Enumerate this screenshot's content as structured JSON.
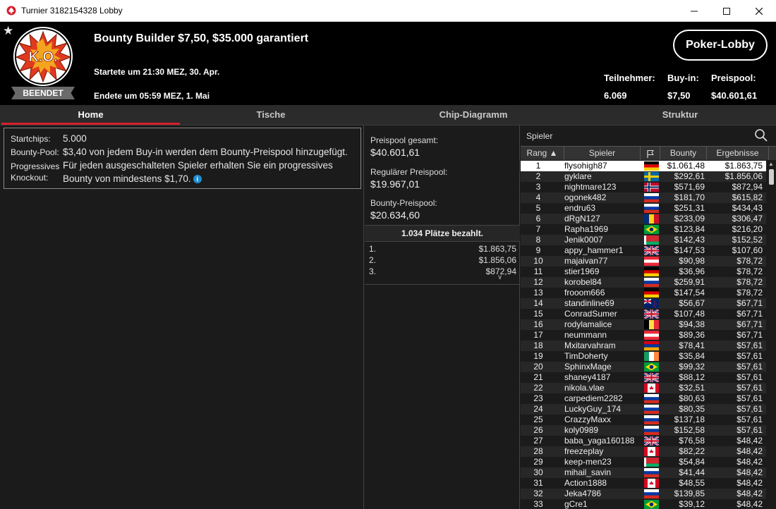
{
  "window": {
    "title": "Turnier 3182154328 Lobby"
  },
  "header": {
    "title": "Bounty Builder $7,50, $35.000 garantiert",
    "started": "Startete um 21:30 MEZ, 30. Apr.",
    "ended": "Endete um 05:59 MEZ, 1. Mai",
    "status_badge": "BEENDET",
    "logo_text": "K.O.",
    "lobby_button": "Poker-Lobby",
    "stats": {
      "players_label": "Teilnehmer:",
      "players_value": "6.069",
      "buyin_label": "Buy-in:",
      "buyin_value": "$7,50",
      "prizepool_label": "Preispool:",
      "prizepool_value": "$40.601,61"
    }
  },
  "tabs": [
    "Home",
    "Tische",
    "Chip-Diagramm",
    "Struktur"
  ],
  "info": {
    "startchips_label": "Startchips:",
    "startchips_value": "5.000",
    "bountypool_label": "Bounty-Pool:",
    "bountypool_value": "$3,40 von jedem Buy-in werden dem Bounty-Preispool hinzugefügt.",
    "pko_label_1": "Progressives",
    "pko_label_2": "Knockout:",
    "pko_value_1": "Für jeden ausgeschalteten Spieler erhalten Sie ein progressives",
    "pko_value_2": "Bounty von mindestens $1,70."
  },
  "prizes": {
    "total_label": "Preispool gesamt:",
    "total_value": "$40.601,61",
    "regular_label": "Regulärer Preispool:",
    "regular_value": "$19.967,01",
    "bounty_label": "Bounty-Preispool:",
    "bounty_value": "$20.634,60",
    "paid_header": "1.034 Plätze bezahlt.",
    "places": [
      {
        "rank": "1.",
        "amount": "$1.863,75"
      },
      {
        "rank": "2.",
        "amount": "$1.856,06"
      },
      {
        "rank": "3.",
        "amount": "$872,94"
      }
    ]
  },
  "players": {
    "search_placeholder": "Spieler",
    "col_rank": "Rang",
    "col_player": "Spieler",
    "col_bounty": "Bounty",
    "col_result": "Ergebnisse",
    "rows": [
      {
        "rank": "1",
        "name": "flysohigh87",
        "flag": "de",
        "bounty": "$1.061,48",
        "result": "$1.863,75"
      },
      {
        "rank": "2",
        "name": "gyklare",
        "flag": "se",
        "bounty": "$292,61",
        "result": "$1.856,06"
      },
      {
        "rank": "3",
        "name": "nightmare123",
        "flag": "no",
        "bounty": "$571,69",
        "result": "$872,94"
      },
      {
        "rank": "4",
        "name": "ogonek482",
        "flag": "ru",
        "bounty": "$181,70",
        "result": "$615,82"
      },
      {
        "rank": "5",
        "name": "endru63",
        "flag": "ru",
        "bounty": "$251,31",
        "result": "$434,43"
      },
      {
        "rank": "6",
        "name": "dRgN127",
        "flag": "ro",
        "bounty": "$233,09",
        "result": "$306,47"
      },
      {
        "rank": "7",
        "name": "Rapha1969",
        "flag": "br",
        "bounty": "$123,84",
        "result": "$216,20"
      },
      {
        "rank": "8",
        "name": "Jenik0007",
        "flag": "by",
        "bounty": "$142,43",
        "result": "$152,52"
      },
      {
        "rank": "9",
        "name": "appy_hammer1",
        "flag": "gb",
        "bounty": "$147,53",
        "result": "$107,60"
      },
      {
        "rank": "10",
        "name": "majaivan77",
        "flag": "at",
        "bounty": "$90,98",
        "result": "$78,72"
      },
      {
        "rank": "11",
        "name": "stier1969",
        "flag": "de",
        "bounty": "$36,96",
        "result": "$78,72"
      },
      {
        "rank": "12",
        "name": "korobel84",
        "flag": "ru",
        "bounty": "$259,91",
        "result": "$78,72"
      },
      {
        "rank": "13",
        "name": "frooom666",
        "flag": "de",
        "bounty": "$147,54",
        "result": "$78,72"
      },
      {
        "rank": "14",
        "name": "standinline69",
        "flag": "nz",
        "bounty": "$56,67",
        "result": "$67,71"
      },
      {
        "rank": "15",
        "name": "ConradSumer",
        "flag": "gb",
        "bounty": "$107,48",
        "result": "$67,71"
      },
      {
        "rank": "16",
        "name": "rodylamalice",
        "flag": "be",
        "bounty": "$94,38",
        "result": "$67,71"
      },
      {
        "rank": "17",
        "name": "neummann",
        "flag": "at",
        "bounty": "$89,36",
        "result": "$67,71"
      },
      {
        "rank": "18",
        "name": "Mxitarvahram",
        "flag": "am",
        "bounty": "$78,41",
        "result": "$57,61"
      },
      {
        "rank": "19",
        "name": "TimDoherty",
        "flag": "ie",
        "bounty": "$35,84",
        "result": "$57,61"
      },
      {
        "rank": "20",
        "name": "SphinxMage",
        "flag": "br",
        "bounty": "$99,32",
        "result": "$57,61"
      },
      {
        "rank": "21",
        "name": "shaney4187",
        "flag": "gb",
        "bounty": "$88,12",
        "result": "$57,61"
      },
      {
        "rank": "22",
        "name": "nikola.vlae",
        "flag": "ca",
        "bounty": "$32,51",
        "result": "$57,61"
      },
      {
        "rank": "23",
        "name": "carpediem2282",
        "flag": "ru",
        "bounty": "$80,63",
        "result": "$57,61"
      },
      {
        "rank": "24",
        "name": "LuckyGuy_174",
        "flag": "ru",
        "bounty": "$80,35",
        "result": "$57,61"
      },
      {
        "rank": "25",
        "name": "CrazzyMaxx",
        "flag": "ru",
        "bounty": "$137,18",
        "result": "$57,61"
      },
      {
        "rank": "26",
        "name": "koly0989",
        "flag": "ru",
        "bounty": "$152,58",
        "result": "$57,61"
      },
      {
        "rank": "27",
        "name": "baba_yaga160188",
        "flag": "gb",
        "bounty": "$76,58",
        "result": "$48,42"
      },
      {
        "rank": "28",
        "name": "freezeplay",
        "flag": "ca",
        "bounty": "$82,22",
        "result": "$48,42"
      },
      {
        "rank": "29",
        "name": "keep-men23",
        "flag": "by",
        "bounty": "$54,84",
        "result": "$48,42"
      },
      {
        "rank": "30",
        "name": "mihail_savin",
        "flag": "ru",
        "bounty": "$41,44",
        "result": "$48,42"
      },
      {
        "rank": "31",
        "name": "Action1888",
        "flag": "ca",
        "bounty": "$48,55",
        "result": "$48,42"
      },
      {
        "rank": "32",
        "name": "Jeka4786",
        "flag": "ru",
        "bounty": "$139,85",
        "result": "$48,42"
      },
      {
        "rank": "33",
        "name": "gCre1",
        "flag": "br",
        "bounty": "$39,12",
        "result": "$48,42"
      }
    ]
  }
}
